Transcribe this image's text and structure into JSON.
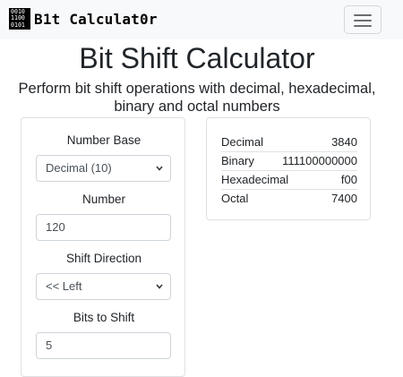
{
  "navbar": {
    "logo_text": "0010\n1100\n0101",
    "brand": "B1t Calculat0r",
    "toggler_icon": "hamburger-menu-icon"
  },
  "page": {
    "title": "Bit Shift Calculator",
    "subtitle": "Perform bit shift operations with decimal, hexadecimal, binary and octal numbers"
  },
  "form": {
    "number_base": {
      "label": "Number Base",
      "selected": "Decimal (10)"
    },
    "number": {
      "label": "Number",
      "value": "120"
    },
    "shift_direction": {
      "label": "Shift Direction",
      "selected": "<< Left"
    },
    "bits_to_shift": {
      "label": "Bits to Shift",
      "value": "5"
    }
  },
  "results": [
    {
      "label": "Decimal",
      "value": "3840"
    },
    {
      "label": "Binary",
      "value": "111100000000"
    },
    {
      "label": "Hexadecimal",
      "value": "f00"
    },
    {
      "label": "Octal",
      "value": "7400"
    }
  ],
  "colors": {
    "navbar_bg": "#f8f9fa",
    "border": "#dfe0e2",
    "text": "#212529"
  }
}
